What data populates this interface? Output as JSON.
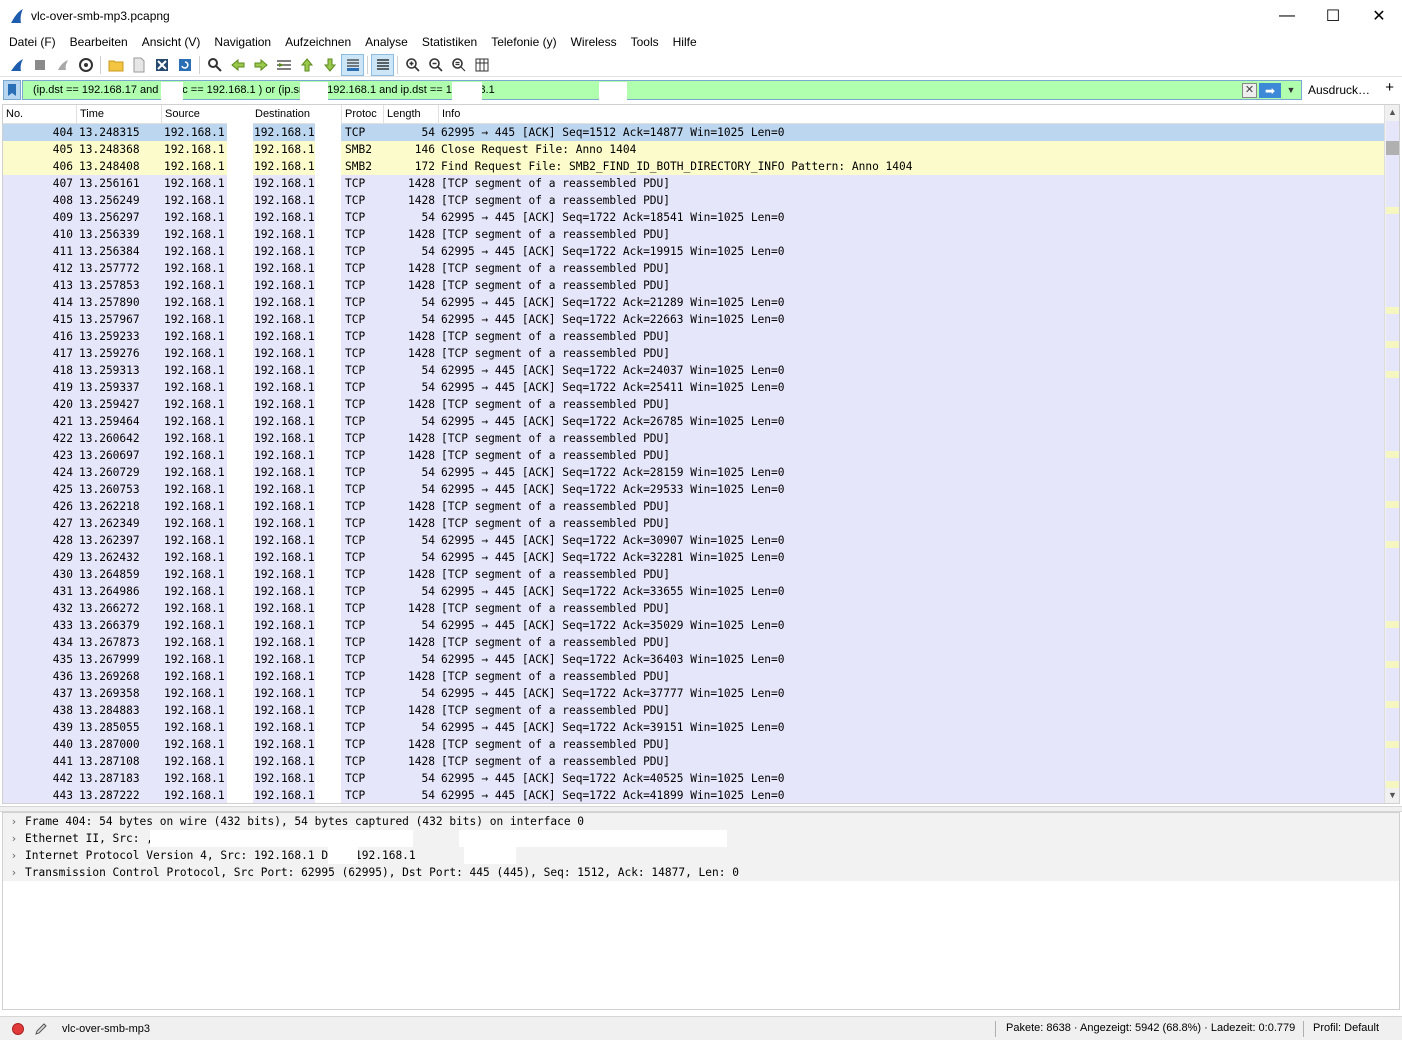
{
  "window": {
    "title": "vlc-over-smb-mp3.pcapng",
    "minimize": "—",
    "maximize": "☐",
    "close": "✕"
  },
  "menu": [
    {
      "name": "menu-datei",
      "label": "Datei (F)"
    },
    {
      "name": "menu-bearbeiten",
      "label": "Bearbeiten"
    },
    {
      "name": "menu-ansicht",
      "label": "Ansicht (V)"
    },
    {
      "name": "menu-navigation",
      "label": "Navigation"
    },
    {
      "name": "menu-aufzeichnen",
      "label": "Aufzeichnen"
    },
    {
      "name": "menu-analyse",
      "label": "Analyse"
    },
    {
      "name": "menu-statistiken",
      "label": "Statistiken"
    },
    {
      "name": "menu-telefonie",
      "label": "Telefonie (y)"
    },
    {
      "name": "menu-wireless",
      "label": "Wireless"
    },
    {
      "name": "menu-tools",
      "label": "Tools"
    },
    {
      "name": "menu-hilfe",
      "label": "Hilfe"
    }
  ],
  "filter": {
    "text": "(ip.dst == 192.168.17          and ip.src == 192.168.1           ) or (ip.src == 192.168.1           and ip.dst == 192.168.1",
    "clear": "✕",
    "apply": "➡",
    "dropdown": "▼",
    "expression_label": "Ausdruck…",
    "add": "+"
  },
  "columns": {
    "no": "No.",
    "time": "Time",
    "source": "Source",
    "destination": "Destination",
    "protocol": "Protoc",
    "length": "Length",
    "info": "Info"
  },
  "colors": {
    "selected": "#bcd6f0",
    "smb": "#fbfbcc",
    "tcp": "#e6e6fa",
    "filter_ok": "#afffaf"
  },
  "packets": [
    {
      "no": "404",
      "time": "13.248315",
      "src": "192.168.1",
      "dst": "192.168.1",
      "proto": "TCP",
      "len": "54",
      "info": "62995 → 445 [ACK] Seq=1512 Ack=14877 Win=1025 Len=0",
      "kind": "selected"
    },
    {
      "no": "405",
      "time": "13.248368",
      "src": "192.168.1",
      "dst": "192.168.1",
      "proto": "SMB2",
      "len": "146",
      "info": "Close Request File: Anno 1404",
      "kind": "smb"
    },
    {
      "no": "406",
      "time": "13.248408",
      "src": "192.168.1",
      "dst": "192.168.1",
      "proto": "SMB2",
      "len": "172",
      "info": "Find Request File:  SMB2_FIND_ID_BOTH_DIRECTORY_INFO Pattern: Anno 1404",
      "kind": "smb"
    },
    {
      "no": "407",
      "time": "13.256161",
      "src": "192.168.1",
      "dst": "192.168.1",
      "proto": "TCP",
      "len": "1428",
      "info": "[TCP segment of a reassembled PDU]",
      "kind": "tcp"
    },
    {
      "no": "408",
      "time": "13.256249",
      "src": "192.168.1",
      "dst": "192.168.1",
      "proto": "TCP",
      "len": "1428",
      "info": "[TCP segment of a reassembled PDU]",
      "kind": "tcp"
    },
    {
      "no": "409",
      "time": "13.256297",
      "src": "192.168.1",
      "dst": "192.168.1",
      "proto": "TCP",
      "len": "54",
      "info": "62995 → 445 [ACK] Seq=1722 Ack=18541 Win=1025 Len=0",
      "kind": "tcp"
    },
    {
      "no": "410",
      "time": "13.256339",
      "src": "192.168.1",
      "dst": "192.168.1",
      "proto": "TCP",
      "len": "1428",
      "info": "[TCP segment of a reassembled PDU]",
      "kind": "tcp"
    },
    {
      "no": "411",
      "time": "13.256384",
      "src": "192.168.1",
      "dst": "192.168.1",
      "proto": "TCP",
      "len": "54",
      "info": "62995 → 445 [ACK] Seq=1722 Ack=19915 Win=1025 Len=0",
      "kind": "tcp"
    },
    {
      "no": "412",
      "time": "13.257772",
      "src": "192.168.1",
      "dst": "192.168.1",
      "proto": "TCP",
      "len": "1428",
      "info": "[TCP segment of a reassembled PDU]",
      "kind": "tcp"
    },
    {
      "no": "413",
      "time": "13.257853",
      "src": "192.168.1",
      "dst": "192.168.1",
      "proto": "TCP",
      "len": "1428",
      "info": "[TCP segment of a reassembled PDU]",
      "kind": "tcp"
    },
    {
      "no": "414",
      "time": "13.257890",
      "src": "192.168.1",
      "dst": "192.168.1",
      "proto": "TCP",
      "len": "54",
      "info": "62995 → 445 [ACK] Seq=1722 Ack=21289 Win=1025 Len=0",
      "kind": "tcp"
    },
    {
      "no": "415",
      "time": "13.257967",
      "src": "192.168.1",
      "dst": "192.168.1",
      "proto": "TCP",
      "len": "54",
      "info": "62995 → 445 [ACK] Seq=1722 Ack=22663 Win=1025 Len=0",
      "kind": "tcp"
    },
    {
      "no": "416",
      "time": "13.259233",
      "src": "192.168.1",
      "dst": "192.168.1",
      "proto": "TCP",
      "len": "1428",
      "info": "[TCP segment of a reassembled PDU]",
      "kind": "tcp"
    },
    {
      "no": "417",
      "time": "13.259276",
      "src": "192.168.1",
      "dst": "192.168.1",
      "proto": "TCP",
      "len": "1428",
      "info": "[TCP segment of a reassembled PDU]",
      "kind": "tcp"
    },
    {
      "no": "418",
      "time": "13.259313",
      "src": "192.168.1",
      "dst": "192.168.1",
      "proto": "TCP",
      "len": "54",
      "info": "62995 → 445 [ACK] Seq=1722 Ack=24037 Win=1025 Len=0",
      "kind": "tcp"
    },
    {
      "no": "419",
      "time": "13.259337",
      "src": "192.168.1",
      "dst": "192.168.1",
      "proto": "TCP",
      "len": "54",
      "info": "62995 → 445 [ACK] Seq=1722 Ack=25411 Win=1025 Len=0",
      "kind": "tcp"
    },
    {
      "no": "420",
      "time": "13.259427",
      "src": "192.168.1",
      "dst": "192.168.1",
      "proto": "TCP",
      "len": "1428",
      "info": "[TCP segment of a reassembled PDU]",
      "kind": "tcp"
    },
    {
      "no": "421",
      "time": "13.259464",
      "src": "192.168.1",
      "dst": "192.168.1",
      "proto": "TCP",
      "len": "54",
      "info": "62995 → 445 [ACK] Seq=1722 Ack=26785 Win=1025 Len=0",
      "kind": "tcp"
    },
    {
      "no": "422",
      "time": "13.260642",
      "src": "192.168.1",
      "dst": "192.168.1",
      "proto": "TCP",
      "len": "1428",
      "info": "[TCP segment of a reassembled PDU]",
      "kind": "tcp"
    },
    {
      "no": "423",
      "time": "13.260697",
      "src": "192.168.1",
      "dst": "192.168.1",
      "proto": "TCP",
      "len": "1428",
      "info": "[TCP segment of a reassembled PDU]",
      "kind": "tcp"
    },
    {
      "no": "424",
      "time": "13.260729",
      "src": "192.168.1",
      "dst": "192.168.1",
      "proto": "TCP",
      "len": "54",
      "info": "62995 → 445 [ACK] Seq=1722 Ack=28159 Win=1025 Len=0",
      "kind": "tcp"
    },
    {
      "no": "425",
      "time": "13.260753",
      "src": "192.168.1",
      "dst": "192.168.1",
      "proto": "TCP",
      "len": "54",
      "info": "62995 → 445 [ACK] Seq=1722 Ack=29533 Win=1025 Len=0",
      "kind": "tcp"
    },
    {
      "no": "426",
      "time": "13.262218",
      "src": "192.168.1",
      "dst": "192.168.1",
      "proto": "TCP",
      "len": "1428",
      "info": "[TCP segment of a reassembled PDU]",
      "kind": "tcp"
    },
    {
      "no": "427",
      "time": "13.262349",
      "src": "192.168.1",
      "dst": "192.168.1",
      "proto": "TCP",
      "len": "1428",
      "info": "[TCP segment of a reassembled PDU]",
      "kind": "tcp"
    },
    {
      "no": "428",
      "time": "13.262397",
      "src": "192.168.1",
      "dst": "192.168.1",
      "proto": "TCP",
      "len": "54",
      "info": "62995 → 445 [ACK] Seq=1722 Ack=30907 Win=1025 Len=0",
      "kind": "tcp"
    },
    {
      "no": "429",
      "time": "13.262432",
      "src": "192.168.1",
      "dst": "192.168.1",
      "proto": "TCP",
      "len": "54",
      "info": "62995 → 445 [ACK] Seq=1722 Ack=32281 Win=1025 Len=0",
      "kind": "tcp"
    },
    {
      "no": "430",
      "time": "13.264859",
      "src": "192.168.1",
      "dst": "192.168.1",
      "proto": "TCP",
      "len": "1428",
      "info": "[TCP segment of a reassembled PDU]",
      "kind": "tcp"
    },
    {
      "no": "431",
      "time": "13.264986",
      "src": "192.168.1",
      "dst": "192.168.1",
      "proto": "TCP",
      "len": "54",
      "info": "62995 → 445 [ACK] Seq=1722 Ack=33655 Win=1025 Len=0",
      "kind": "tcp"
    },
    {
      "no": "432",
      "time": "13.266272",
      "src": "192.168.1",
      "dst": "192.168.1",
      "proto": "TCP",
      "len": "1428",
      "info": "[TCP segment of a reassembled PDU]",
      "kind": "tcp"
    },
    {
      "no": "433",
      "time": "13.266379",
      "src": "192.168.1",
      "dst": "192.168.1",
      "proto": "TCP",
      "len": "54",
      "info": "62995 → 445 [ACK] Seq=1722 Ack=35029 Win=1025 Len=0",
      "kind": "tcp"
    },
    {
      "no": "434",
      "time": "13.267873",
      "src": "192.168.1",
      "dst": "192.168.1",
      "proto": "TCP",
      "len": "1428",
      "info": "[TCP segment of a reassembled PDU]",
      "kind": "tcp"
    },
    {
      "no": "435",
      "time": "13.267999",
      "src": "192.168.1",
      "dst": "192.168.1",
      "proto": "TCP",
      "len": "54",
      "info": "62995 → 445 [ACK] Seq=1722 Ack=36403 Win=1025 Len=0",
      "kind": "tcp"
    },
    {
      "no": "436",
      "time": "13.269268",
      "src": "192.168.1",
      "dst": "192.168.1",
      "proto": "TCP",
      "len": "1428",
      "info": "[TCP segment of a reassembled PDU]",
      "kind": "tcp"
    },
    {
      "no": "437",
      "time": "13.269358",
      "src": "192.168.1",
      "dst": "192.168.1",
      "proto": "TCP",
      "len": "54",
      "info": "62995 → 445 [ACK] Seq=1722 Ack=37777 Win=1025 Len=0",
      "kind": "tcp"
    },
    {
      "no": "438",
      "time": "13.284883",
      "src": "192.168.1",
      "dst": "192.168.1",
      "proto": "TCP",
      "len": "1428",
      "info": "[TCP segment of a reassembled PDU]",
      "kind": "tcp"
    },
    {
      "no": "439",
      "time": "13.285055",
      "src": "192.168.1",
      "dst": "192.168.1",
      "proto": "TCP",
      "len": "54",
      "info": "62995 → 445 [ACK] Seq=1722 Ack=39151 Win=1025 Len=0",
      "kind": "tcp"
    },
    {
      "no": "440",
      "time": "13.287000",
      "src": "192.168.1",
      "dst": "192.168.1",
      "proto": "TCP",
      "len": "1428",
      "info": "[TCP segment of a reassembled PDU]",
      "kind": "tcp"
    },
    {
      "no": "441",
      "time": "13.287108",
      "src": "192.168.1",
      "dst": "192.168.1",
      "proto": "TCP",
      "len": "1428",
      "info": "[TCP segment of a reassembled PDU]",
      "kind": "tcp"
    },
    {
      "no": "442",
      "time": "13.287183",
      "src": "192.168.1",
      "dst": "192.168.1",
      "proto": "TCP",
      "len": "54",
      "info": "62995 → 445 [ACK] Seq=1722 Ack=40525 Win=1025 Len=0",
      "kind": "tcp"
    },
    {
      "no": "443",
      "time": "13.287222",
      "src": "192.168.1",
      "dst": "192.168.1",
      "proto": "TCP",
      "len": "54",
      "info": "62995 → 445 [ACK] Seq=1722 Ack=41899 Win=1025 Len=0",
      "kind": "tcp"
    }
  ],
  "details": [
    {
      "text": "Frame 404: 54 bytes on wire (432 bits), 54 bytes captured (432 bits) on interface 0"
    },
    {
      "text": "Ethernet II, Src:                                   , Dst:"
    },
    {
      "text": "Internet Protocol Version 4, Src: 192.168.1       Dst: 192.168.1"
    },
    {
      "text": "Transmission Control Protocol, Src Port: 62995 (62995), Dst Port: 445 (445), Seq: 1512, Ack: 14877, Len: 0"
    }
  ],
  "status": {
    "file": "vlc-over-smb-mp3",
    "stats": "Pakete: 8638 · Angezeigt: 5942 (68.8%) · Ladezeit: 0:0.779",
    "profile": "Profil: Default"
  }
}
